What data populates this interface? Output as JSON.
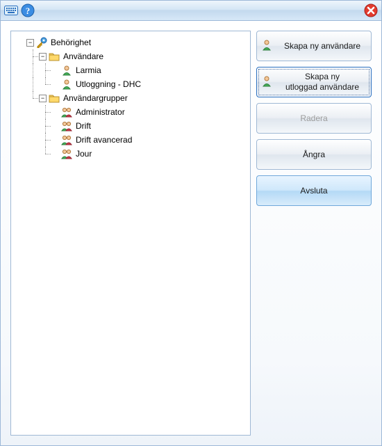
{
  "titlebar": {
    "keyboard_icon": "keyboard-icon",
    "help_icon": "help-icon",
    "close_icon": "close-icon"
  },
  "tree": {
    "root": {
      "label": "Behörighet",
      "expanded": true,
      "children": {
        "users": {
          "label": "Användare",
          "expanded": true,
          "items": [
            {
              "label": "Larmia"
            },
            {
              "label": "Utloggning - DHC"
            }
          ]
        },
        "groups": {
          "label": "Användargrupper",
          "expanded": true,
          "items": [
            {
              "label": "Administrator"
            },
            {
              "label": "Drift"
            },
            {
              "label": "Drift avancerad"
            },
            {
              "label": "Jour"
            }
          ]
        }
      }
    }
  },
  "buttons": {
    "create_user": "Skapa ny användare",
    "create_logged_out_user_line1": "Skapa ny",
    "create_logged_out_user_line2": "utloggad användare",
    "delete": "Radera",
    "undo": "Ångra",
    "close": "Avsluta"
  },
  "expander": {
    "minus": "−",
    "plus": "+"
  }
}
